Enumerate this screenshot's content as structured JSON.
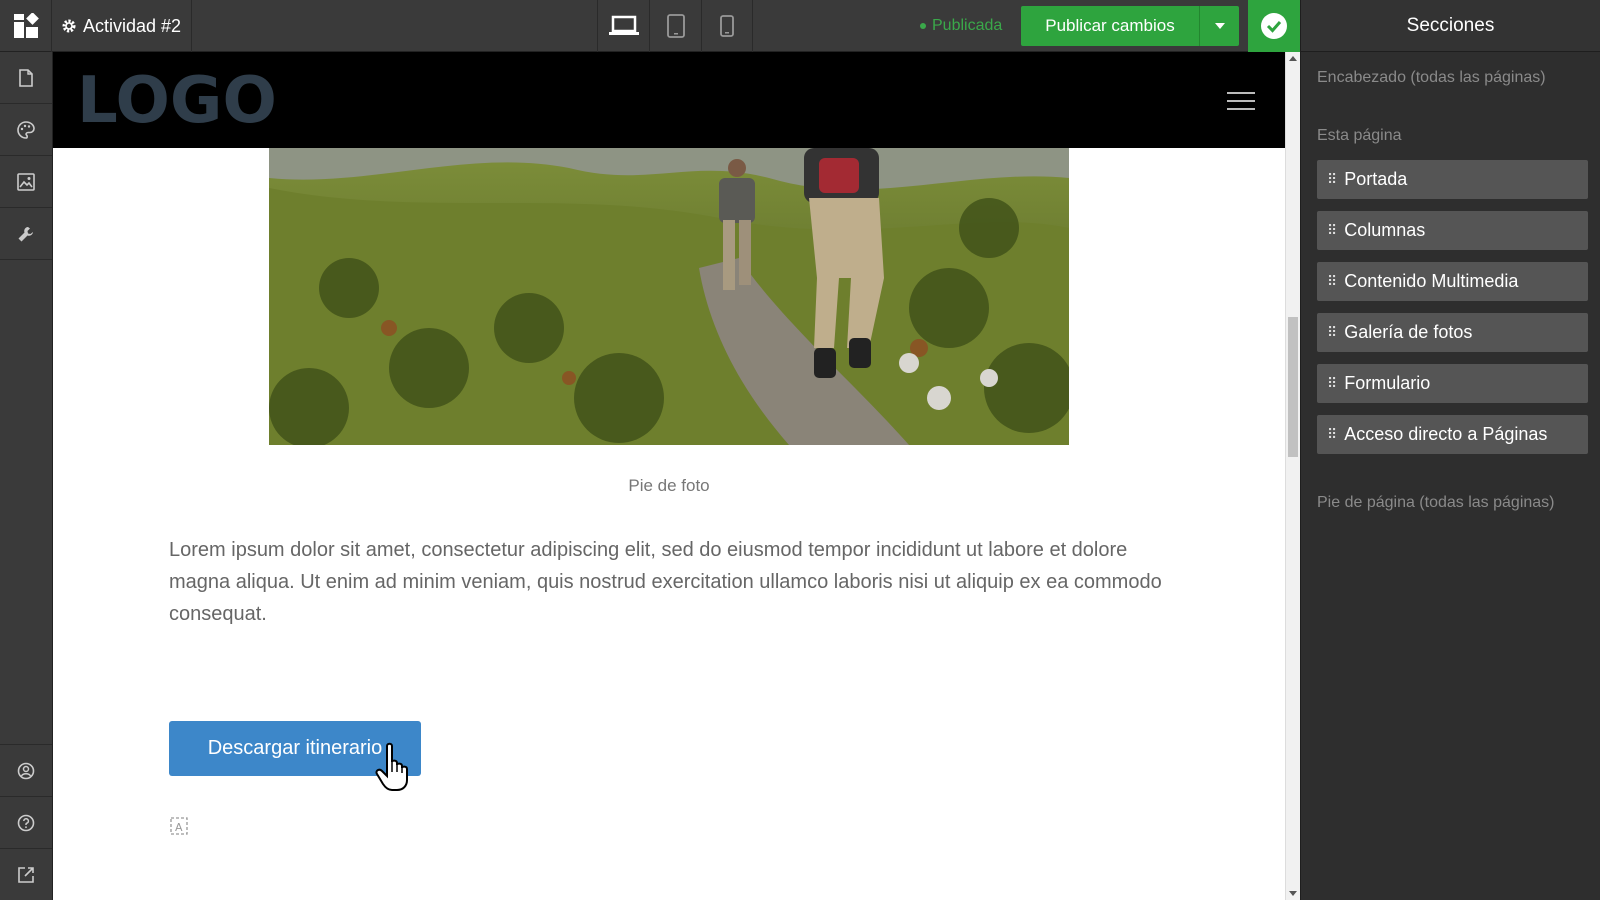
{
  "topbar": {
    "site_title": "Actividad #2",
    "status": "Publicada",
    "publish_label": "Publicar cambios"
  },
  "colors": {
    "accent_green": "#2ea43e",
    "button_blue": "#3d87c9"
  },
  "rail": {
    "top_icons": [
      "page-icon",
      "palette-icon",
      "image-icon",
      "wrench-icon"
    ],
    "bottom_icons": [
      "account-icon",
      "help-icon",
      "external-link-icon"
    ]
  },
  "canvas": {
    "logo_text": "LOGO",
    "caption": "Pie de foto",
    "body": "Lorem ipsum dolor sit amet, consectetur adipiscing elit, sed do eiusmod tempor incididunt ut labore et dolore magna aliqua. Ut enim ad minim veniam, quis nostrud exercitation ullamco laboris nisi ut aliquip ex ea commodo consequat.",
    "cta_label": "Descargar itinerario"
  },
  "panel": {
    "title": "Secciones",
    "header_label": "Encabezado (todas las páginas)",
    "page_label": "Esta página",
    "sections": [
      "Portada",
      "Columnas",
      "Contenido Multimedia",
      "Galería de fotos",
      "Formulario",
      "Acceso directo a Páginas"
    ],
    "footer_label": "Pie de página (todas las páginas)"
  }
}
